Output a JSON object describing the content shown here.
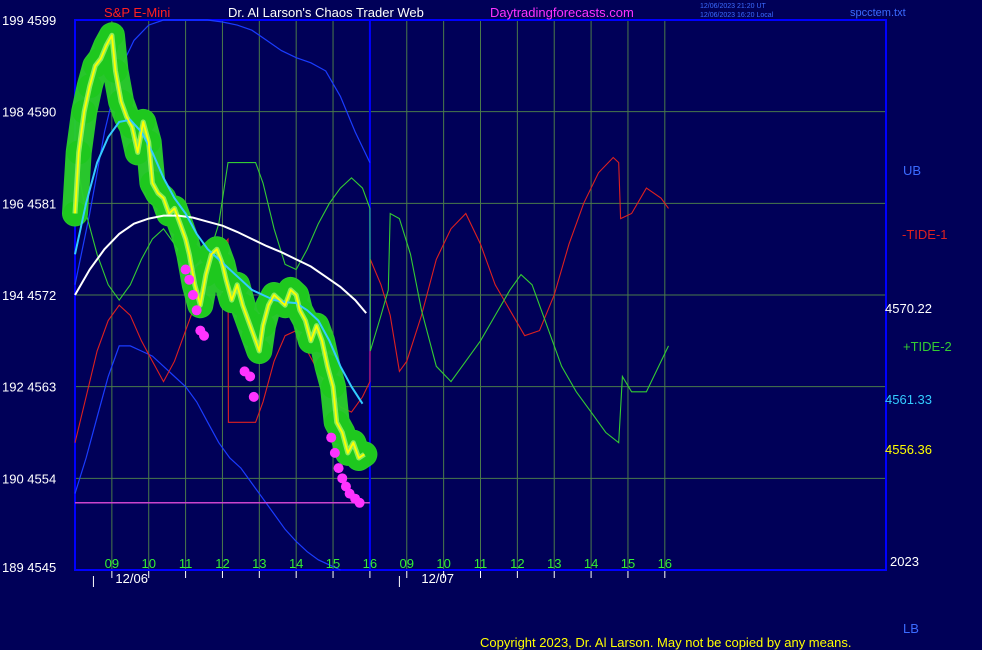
{
  "header": {
    "symbol": "S&P E-Mini",
    "title": "Dr. Al Larson's Chaos Trader Web",
    "site": "Daytradingforecasts.com",
    "stamp_line1": "12/06/2023 21:20 UT",
    "stamp_line2": "12/06/2023 16:20 Local",
    "file": "spcctem.txt"
  },
  "copyright": "Copyright 2023, Dr. Al Larson. May not be copied by any means.",
  "colors": {
    "background": "#000058",
    "frame": "#0000ff",
    "grid": "#4a7a4a",
    "price_band": "#2ad12a",
    "price_line": "#ffff00",
    "fast_ma": "#33ccff",
    "slow_ma": "#ffffff",
    "tide1": "#dd2020",
    "tide2": "#33cc33",
    "envelope": "#1a3cff",
    "low_marker": "#ff33ff",
    "low_line": "#cc44cc"
  },
  "chart_data": {
    "type": "line",
    "y_axis": {
      "ticks": [
        {
          "left": "199",
          "right": "4599",
          "value": 4599
        },
        {
          "left": "198",
          "right": "4590",
          "value": 4590
        },
        {
          "left": "196",
          "right": "4581",
          "value": 4581
        },
        {
          "left": "194",
          "right": "4572",
          "value": 4572
        },
        {
          "left": "192",
          "right": "4563",
          "value": 4563
        },
        {
          "left": "190",
          "right": "4554",
          "value": 4554
        },
        {
          "left": "189",
          "right": "4545",
          "value": 4545
        }
      ],
      "ylim": [
        4545,
        4599
      ]
    },
    "x_axis": {
      "xlim": [
        8.0,
        30.0
      ],
      "ticks": [
        {
          "label": "09",
          "x": 9
        },
        {
          "label": "10",
          "x": 10
        },
        {
          "label": "11",
          "x": 11
        },
        {
          "label": "12",
          "x": 12
        },
        {
          "label": "13",
          "x": 13
        },
        {
          "label": "14",
          "x": 14
        },
        {
          "label": "15",
          "x": 15
        },
        {
          "label": "16",
          "x": 16
        },
        {
          "label": "09",
          "x": 17
        },
        {
          "label": "10",
          "x": 18
        },
        {
          "label": "11",
          "x": 19
        },
        {
          "label": "12",
          "x": 20
        },
        {
          "label": "13",
          "x": 21
        },
        {
          "label": "14",
          "x": 22
        },
        {
          "label": "15",
          "x": 23
        },
        {
          "label": "16",
          "x": 24
        }
      ],
      "dates": [
        {
          "label": "12/06",
          "x": 8.5
        },
        {
          "label": "12/07",
          "x": 16.8
        }
      ],
      "year_label": "2023"
    },
    "current_day_end_x": 16.0,
    "right_labels": {
      "ub": "UB",
      "lb": "LB",
      "tide1": "-TIDE-1",
      "tide2": "+TIDE-2",
      "slow_ma_value": "4570.22",
      "fast_ma_value": "4561.33",
      "price_value": "4556.36"
    },
    "low_line_value": 4551.6,
    "price": [
      [
        8.0,
        4580.0
      ],
      [
        8.1,
        4586.0
      ],
      [
        8.25,
        4590.0
      ],
      [
        8.4,
        4592.5
      ],
      [
        8.55,
        4594.5
      ],
      [
        8.7,
        4595.2
      ],
      [
        8.85,
        4596.5
      ],
      [
        9.0,
        4597.5
      ],
      [
        9.1,
        4594.0
      ],
      [
        9.25,
        4591.0
      ],
      [
        9.4,
        4589.5
      ],
      [
        9.55,
        4588.5
      ],
      [
        9.7,
        4586.0
      ],
      [
        9.85,
        4589.0
      ],
      [
        10.0,
        4587.0
      ],
      [
        10.1,
        4583.0
      ],
      [
        10.25,
        4582.0
      ],
      [
        10.4,
        4581.5
      ],
      [
        10.55,
        4580.0
      ],
      [
        10.7,
        4580.5
      ],
      [
        10.85,
        4579.0
      ],
      [
        11.0,
        4577.5
      ],
      [
        11.1,
        4576.0
      ],
      [
        11.25,
        4573.0
      ],
      [
        11.4,
        4571.0
      ],
      [
        11.55,
        4574.0
      ],
      [
        11.7,
        4576.0
      ],
      [
        11.85,
        4576.5
      ],
      [
        12.0,
        4575.0
      ],
      [
        12.1,
        4573.5
      ],
      [
        12.25,
        4571.5
      ],
      [
        12.4,
        4573.0
      ],
      [
        12.55,
        4571.0
      ],
      [
        12.7,
        4569.5
      ],
      [
        12.85,
        4568.0
      ],
      [
        13.0,
        4566.5
      ],
      [
        13.1,
        4569.0
      ],
      [
        13.25,
        4571.0
      ],
      [
        13.4,
        4572.0
      ],
      [
        13.55,
        4571.5
      ],
      [
        13.7,
        4571.0
      ],
      [
        13.85,
        4572.5
      ],
      [
        14.0,
        4572.0
      ],
      [
        14.1,
        4570.5
      ],
      [
        14.25,
        4569.5
      ],
      [
        14.4,
        4567.5
      ],
      [
        14.55,
        4569.0
      ],
      [
        14.7,
        4567.5
      ],
      [
        14.85,
        4565.0
      ],
      [
        15.0,
        4563.0
      ],
      [
        15.1,
        4559.5
      ],
      [
        15.25,
        4558.5
      ],
      [
        15.4,
        4556.5
      ],
      [
        15.55,
        4557.5
      ],
      [
        15.7,
        4556.0
      ],
      [
        15.85,
        4556.36
      ]
    ],
    "price_lows": [
      [
        11.0,
        4574.5
      ],
      [
        11.1,
        4573.5
      ],
      [
        11.2,
        4572.0
      ],
      [
        11.3,
        4570.5
      ],
      [
        11.4,
        4568.5
      ],
      [
        11.5,
        4568.0
      ],
      [
        12.6,
        4564.5
      ],
      [
        12.75,
        4564.0
      ],
      [
        12.85,
        4562.0
      ],
      [
        14.95,
        4558.0
      ],
      [
        15.05,
        4556.5
      ],
      [
        15.15,
        4555.0
      ],
      [
        15.25,
        4554.0
      ],
      [
        15.35,
        4553.2
      ],
      [
        15.45,
        4552.5
      ],
      [
        15.6,
        4552.0
      ],
      [
        15.72,
        4551.6
      ]
    ],
    "fast_ma": [
      [
        8.0,
        4576.0
      ],
      [
        8.3,
        4581.0
      ],
      [
        8.6,
        4585.0
      ],
      [
        8.9,
        4587.5
      ],
      [
        9.2,
        4589.0
      ],
      [
        9.5,
        4589.2
      ],
      [
        9.8,
        4588.0
      ],
      [
        10.1,
        4586.0
      ],
      [
        10.4,
        4583.5
      ],
      [
        10.7,
        4581.5
      ],
      [
        11.0,
        4580.0
      ],
      [
        11.3,
        4578.0
      ],
      [
        11.6,
        4576.5
      ],
      [
        11.9,
        4575.5
      ],
      [
        12.2,
        4574.5
      ],
      [
        12.5,
        4573.5
      ],
      [
        12.8,
        4572.5
      ],
      [
        13.1,
        4572.0
      ],
      [
        13.4,
        4571.5
      ],
      [
        13.7,
        4571.3
      ],
      [
        14.0,
        4571.2
      ],
      [
        14.3,
        4570.5
      ],
      [
        14.6,
        4569.5
      ],
      [
        14.9,
        4567.5
      ],
      [
        15.2,
        4565.0
      ],
      [
        15.5,
        4563.0
      ],
      [
        15.8,
        4561.33
      ]
    ],
    "slow_ma": [
      [
        8.0,
        4572.0
      ],
      [
        8.4,
        4574.5
      ],
      [
        8.8,
        4576.5
      ],
      [
        9.2,
        4578.0
      ],
      [
        9.6,
        4579.0
      ],
      [
        10.0,
        4579.5
      ],
      [
        10.4,
        4579.8
      ],
      [
        10.8,
        4579.8
      ],
      [
        11.2,
        4579.6
      ],
      [
        11.6,
        4579.2
      ],
      [
        12.0,
        4578.8
      ],
      [
        12.4,
        4578.2
      ],
      [
        12.8,
        4577.5
      ],
      [
        13.2,
        4576.8
      ],
      [
        13.6,
        4576.2
      ],
      [
        14.0,
        4575.5
      ],
      [
        14.4,
        4574.8
      ],
      [
        14.8,
        4573.8
      ],
      [
        15.2,
        4572.8
      ],
      [
        15.6,
        4571.5
      ],
      [
        15.9,
        4570.22
      ]
    ],
    "tide1": [
      [
        8.0,
        4557.5
      ],
      [
        8.3,
        4562.0
      ],
      [
        8.6,
        4566.5
      ],
      [
        8.9,
        4569.5
      ],
      [
        9.2,
        4571.0
      ],
      [
        9.5,
        4570.0
      ],
      [
        9.8,
        4567.5
      ],
      [
        10.1,
        4565.5
      ],
      [
        10.4,
        4563.5
      ],
      [
        10.7,
        4565.5
      ],
      [
        11.0,
        4568.5
      ],
      [
        11.3,
        4571.5
      ],
      [
        11.6,
        4574.5
      ],
      [
        11.9,
        4576.5
      ],
      [
        12.15,
        4577.5
      ],
      [
        12.16,
        4559.5
      ],
      [
        12.9,
        4559.5
      ],
      [
        13.1,
        4561.5
      ],
      [
        13.4,
        4565.5
      ],
      [
        13.7,
        4568.0
      ],
      [
        14.0,
        4568.5
      ],
      [
        14.3,
        4566.5
      ],
      [
        14.6,
        4564.5
      ],
      [
        14.9,
        4562.5
      ],
      [
        15.2,
        4561.0
      ],
      [
        15.5,
        4560.5
      ],
      [
        15.8,
        4562.0
      ],
      [
        16.0,
        4563.5
      ],
      [
        16.01,
        4575.5
      ],
      [
        16.3,
        4573.0
      ],
      [
        16.55,
        4570.0
      ],
      [
        16.8,
        4564.5
      ],
      [
        17.0,
        4565.5
      ],
      [
        17.4,
        4570.0
      ],
      [
        17.8,
        4575.5
      ],
      [
        18.2,
        4578.5
      ],
      [
        18.6,
        4580.0
      ],
      [
        19.0,
        4577.0
      ],
      [
        19.4,
        4573.0
      ],
      [
        19.8,
        4570.5
      ],
      [
        20.2,
        4568.0
      ],
      [
        20.6,
        4568.5
      ],
      [
        21.0,
        4572.0
      ],
      [
        21.4,
        4577.0
      ],
      [
        21.8,
        4581.0
      ],
      [
        22.2,
        4584.0
      ],
      [
        22.6,
        4585.5
      ],
      [
        22.75,
        4585.0
      ],
      [
        22.8,
        4579.5
      ],
      [
        23.1,
        4580.0
      ],
      [
        23.5,
        4582.5
      ],
      [
        23.9,
        4581.5
      ],
      [
        24.1,
        4580.5
      ]
    ],
    "tide2": [
      [
        8.0,
        4586.0
      ],
      [
        8.3,
        4580.0
      ],
      [
        8.6,
        4576.0
      ],
      [
        8.9,
        4573.0
      ],
      [
        9.2,
        4571.5
      ],
      [
        9.5,
        4573.0
      ],
      [
        9.8,
        4575.5
      ],
      [
        10.1,
        4577.5
      ],
      [
        10.4,
        4578.5
      ],
      [
        10.7,
        4577.0
      ],
      [
        11.0,
        4575.0
      ],
      [
        11.3,
        4574.5
      ],
      [
        11.6,
        4575.5
      ],
      [
        11.9,
        4579.0
      ],
      [
        12.15,
        4585.0
      ],
      [
        12.9,
        4585.0
      ],
      [
        13.1,
        4583.0
      ],
      [
        13.4,
        4578.5
      ],
      [
        13.7,
        4575.0
      ],
      [
        14.0,
        4574.5
      ],
      [
        14.3,
        4576.5
      ],
      [
        14.6,
        4579.0
      ],
      [
        14.9,
        4581.0
      ],
      [
        15.2,
        4582.5
      ],
      [
        15.5,
        4583.5
      ],
      [
        15.8,
        4582.5
      ],
      [
        16.0,
        4580.5
      ],
      [
        16.01,
        4566.5
      ],
      [
        16.3,
        4570.0
      ],
      [
        16.5,
        4572.5
      ],
      [
        16.55,
        4580.0
      ],
      [
        16.8,
        4579.5
      ],
      [
        17.1,
        4576.0
      ],
      [
        17.4,
        4570.5
      ],
      [
        17.8,
        4565.0
      ],
      [
        18.2,
        4563.5
      ],
      [
        18.6,
        4565.5
      ],
      [
        19.0,
        4567.5
      ],
      [
        19.4,
        4570.0
      ],
      [
        19.8,
        4572.5
      ],
      [
        20.1,
        4574.0
      ],
      [
        20.4,
        4573.0
      ],
      [
        20.8,
        4569.0
      ],
      [
        21.2,
        4565.0
      ],
      [
        21.6,
        4562.5
      ],
      [
        22.0,
        4560.5
      ],
      [
        22.4,
        4558.5
      ],
      [
        22.75,
        4557.5
      ],
      [
        22.85,
        4564.0
      ],
      [
        23.1,
        4562.5
      ],
      [
        23.5,
        4562.5
      ],
      [
        23.9,
        4565.5
      ],
      [
        24.1,
        4567.0
      ]
    ],
    "upper_band": [
      [
        8.0,
        4573.0
      ],
      [
        8.4,
        4580.0
      ],
      [
        8.8,
        4588.0
      ],
      [
        9.2,
        4594.0
      ],
      [
        9.6,
        4597.0
      ],
      [
        10.0,
        4598.5
      ],
      [
        10.4,
        4599.0
      ],
      [
        10.8,
        4599.0
      ],
      [
        11.2,
        4599.0
      ],
      [
        11.6,
        4599.0
      ],
      [
        12.0,
        4598.8
      ],
      [
        12.4,
        4598.5
      ],
      [
        12.8,
        4598.0
      ],
      [
        13.2,
        4597.0
      ],
      [
        13.6,
        4596.0
      ],
      [
        14.0,
        4595.3
      ],
      [
        14.4,
        4594.8
      ],
      [
        14.8,
        4594.0
      ],
      [
        15.2,
        4591.5
      ],
      [
        15.6,
        4588.0
      ],
      [
        16.0,
        4585.0
      ]
    ],
    "lower_band": [
      [
        8.0,
        4552.5
      ],
      [
        8.3,
        4556.0
      ],
      [
        8.6,
        4560.0
      ],
      [
        8.9,
        4564.0
      ],
      [
        9.2,
        4567.0
      ],
      [
        9.5,
        4567.0
      ],
      [
        9.8,
        4566.5
      ],
      [
        10.1,
        4566.0
      ],
      [
        10.4,
        4565.0
      ],
      [
        10.7,
        4564.0
      ],
      [
        11.0,
        4563.0
      ],
      [
        11.3,
        4561.5
      ],
      [
        11.6,
        4559.5
      ],
      [
        11.9,
        4557.5
      ],
      [
        12.2,
        4556.0
      ],
      [
        12.5,
        4555.0
      ],
      [
        12.8,
        4553.5
      ],
      [
        13.1,
        4552.0
      ],
      [
        13.4,
        4550.5
      ],
      [
        13.7,
        4549.0
      ],
      [
        14.0,
        4547.8
      ],
      [
        14.3,
        4546.8
      ],
      [
        14.6,
        4546.0
      ],
      [
        14.9,
        4545.5
      ],
      [
        15.2,
        4545.0
      ]
    ]
  }
}
